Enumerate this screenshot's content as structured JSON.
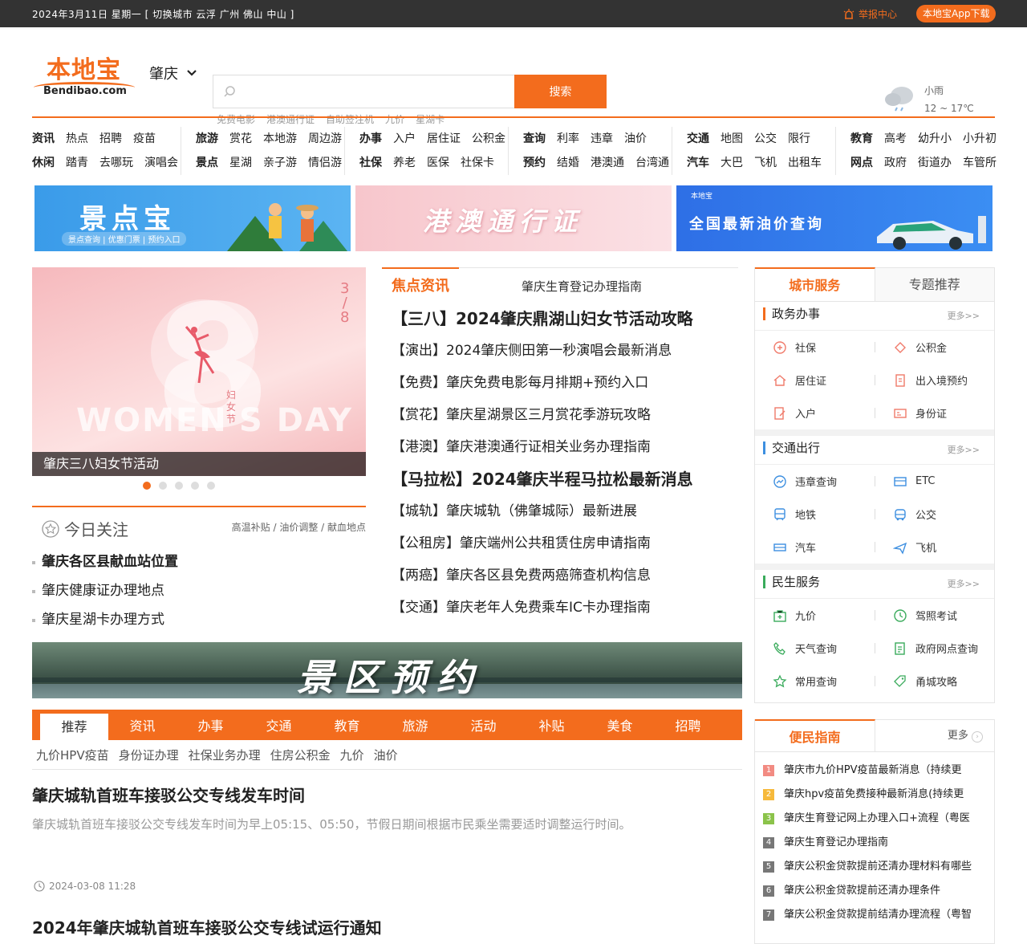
{
  "topbar": {
    "date_text": "2024年3月11日 星期一 [ 切换城市 云浮 广州 佛山 中山 ]",
    "report_label": "举报中心",
    "app_label": "本地宝App下载"
  },
  "header": {
    "logo_cn": "本地宝",
    "logo_en": "Bendibao.com",
    "city": "肇庆",
    "search": {
      "placeholder": "",
      "button": "搜索"
    },
    "hotwords": [
      "免费电影",
      "港澳通行证",
      "自助签注机",
      "九价",
      "星湖卡"
    ],
    "weather": {
      "desc": "小雨",
      "temp": "12 ~ 17℃"
    }
  },
  "nav": {
    "groups": [
      {
        "row1": [
          "资讯",
          "热点",
          "招聘",
          "疫苗"
        ],
        "row2": [
          "休闲",
          "踏青",
          "去哪玩",
          "演唱会"
        ]
      },
      {
        "row1": [
          "旅游",
          "赏花",
          "本地游",
          "周边游"
        ],
        "row2": [
          "景点",
          "星湖",
          "亲子游",
          "情侣游"
        ]
      },
      {
        "row1": [
          "办事",
          "入户",
          "居住证",
          "公积金"
        ],
        "row2": [
          "社保",
          "养老",
          "医保",
          "社保卡"
        ]
      },
      {
        "row1": [
          "查询",
          "利率",
          "违章",
          "油价"
        ],
        "row2": [
          "预约",
          "结婚",
          "港澳通",
          "台湾通"
        ]
      },
      {
        "row1": [
          "交通",
          "地图",
          "公交",
          "限行"
        ],
        "row2": [
          "汽车",
          "大巴",
          "飞机",
          "出租车"
        ]
      },
      {
        "row1": [
          "教育",
          "高考",
          "幼升小",
          "小升初"
        ],
        "row2": [
          "网点",
          "政府",
          "街道办",
          "车管所"
        ]
      }
    ]
  },
  "banners": {
    "b1_title": "景点宝",
    "b1_sub": "景点查询 | 优惠门票 | 预约入口",
    "b2_title": "港澳通行证",
    "b3_tag": "本地宝",
    "b3_title": "全国最新油价查询"
  },
  "slider": {
    "frac_top": "3",
    "frac_mid": "/",
    "frac_bot": "8",
    "bg_text": "WOMEN'S DAY",
    "vert_text": "妇女节",
    "caption": "肇庆三八妇女节活动"
  },
  "today": {
    "title": "今日关注",
    "tags": "高温补贴 / 油价调整 / 献血地点",
    "items": [
      "肇庆各区县献血站位置",
      "肇庆健康证办理地点",
      "肇庆星湖卡办理方式"
    ]
  },
  "focus": {
    "tab1": "焦点资讯",
    "tab2": "肇庆生育登记办理指南",
    "items": [
      "【三八】2024肇庆鼎湖山妇女节活动攻略",
      "【演出】2024肇庆侧田第一秒演唱会最新消息",
      "【免费】肇庆免费电影每月排期+预约入口",
      "【赏花】肇庆星湖景区三月赏花季游玩攻略",
      "【港澳】肇庆港澳通行证相关业务办理指南",
      "【马拉松】2024肇庆半程马拉松最新消息",
      "【城轨】肇庆城轨（佛肇城际）最新进展",
      "【公租房】肇庆端州公共租赁住房申请指南",
      "【两癌】肇庆各区县免费两癌筛查机构信息",
      "【交通】肇庆老年人免费乘车IC卡办理指南"
    ]
  },
  "scenic_banner": "景区预约",
  "recnav": [
    "推荐",
    "资讯",
    "办事",
    "交通",
    "教育",
    "旅游",
    "活动",
    "补贴",
    "美食",
    "招聘"
  ],
  "subtags": [
    "九价HPV疫苗",
    "身份证办理",
    "社保业务办理",
    "住房公积金",
    "九价",
    "油价"
  ],
  "articles": [
    {
      "title": "肇庆城轨首班车接驳公交专线发车时间",
      "summary": "肇庆城轨首班车接驳公交专线发车时间为早上05:15、05:50，节假日期间根据市民乘坐需要适时调整运行时间。",
      "time": "2024-03-08 11:28"
    },
    {
      "title": "2024年肇庆城轨首班车接驳公交专线试运行通知"
    }
  ],
  "services": {
    "tab_on": "城市服务",
    "tab_off": "专题推荐",
    "more": "更多>>",
    "sections": [
      {
        "title": "政务办事",
        "items": [
          "社保",
          "公积金",
          "居住证",
          "出入境预约",
          "入户",
          "身份证"
        ]
      },
      {
        "title": "交通出行",
        "items": [
          "违章查询",
          "ETC",
          "地铁",
          "公交",
          "汽车",
          "飞机"
        ]
      },
      {
        "title": "民生服务",
        "items": [
          "九价",
          "驾照考试",
          "天气查询",
          "政府网点查询",
          "常用查询",
          "甬城攻略"
        ]
      }
    ]
  },
  "guide": {
    "title": "便民指南",
    "more": "更多",
    "items": [
      "肇庆市九价HPV疫苗最新消息（持续更",
      "肇庆hpv疫苗免费接种最新消息(持续更",
      "肇庆生育登记网上办理入口+流程（粤医",
      "肇庆生育登记办理指南",
      "肇庆公积金贷款提前还清办理材料有哪些",
      "肇庆公积金贷款提前还清办理条件",
      "肇庆公积金贷款提前结清办理流程（粤智"
    ],
    "num_colors": [
      "#f28b82",
      "#f6b93b",
      "#8bc34a",
      "#777777",
      "#777777",
      "#777777",
      "#777777"
    ]
  },
  "colors": {
    "accent": "#f36c1d",
    "topbar": "#333333"
  }
}
